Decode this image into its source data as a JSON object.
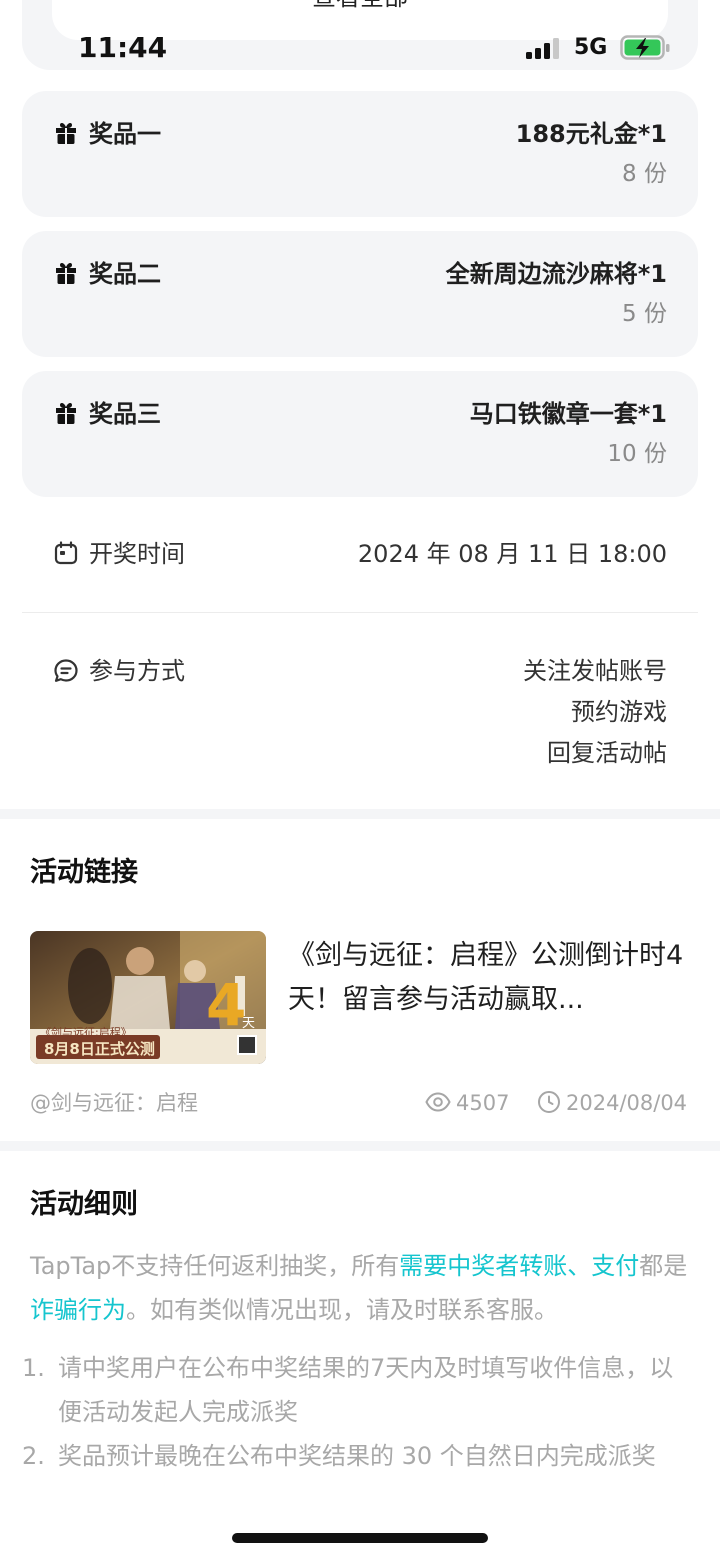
{
  "status_bar": {
    "time": "11:44",
    "network": "5G",
    "signal_bars": 3,
    "battery": "charging"
  },
  "top_card": {
    "view_all_label": "查看全部"
  },
  "prizes": [
    {
      "label": "奖品一",
      "name": "188元礼金*1",
      "count": "8 份"
    },
    {
      "label": "奖品二",
      "name": "全新周边流沙麻将*1",
      "count": "5 份"
    },
    {
      "label": "奖品三",
      "name": "马口铁徽章一套*1",
      "count": "10 份"
    }
  ],
  "draw_time": {
    "label": "开奖时间",
    "value": "2024 年 08 月 11 日 18:00"
  },
  "participation": {
    "label": "参与方式",
    "methods": [
      "关注发帖账号",
      "预约游戏",
      "回复活动帖"
    ]
  },
  "activity_link": {
    "section_title": "活动链接",
    "title": "《剑与远征：启程》公测倒计时4天！留言参与活动赢取...",
    "thumb_caption": "《剑与远征:启程》",
    "thumb_date_text": "8月8日正式公测",
    "thumb_big_number": "4",
    "thumb_day_char": "天",
    "author": "@剑与远征：启程",
    "views": "4507",
    "date": "2024/08/04"
  },
  "rules": {
    "section_title": "活动细则",
    "warning_parts": [
      {
        "text": "TapTap不支持任何返利抽奖，所有",
        "highlight": false
      },
      {
        "text": "需要中奖者转账、支付",
        "highlight": true
      },
      {
        "text": "都是",
        "highlight": false
      },
      {
        "text": "诈骗行为",
        "highlight": true
      },
      {
        "text": "。如有类似情况出现，请及时联系客服。",
        "highlight": false
      }
    ],
    "items": [
      {
        "num": "1.",
        "text": "请中奖用户在公布中奖结果的7天内及时填写收件信息，以便活动发起人完成派奖"
      },
      {
        "num": "2.",
        "text": "奖品预计最晚在公布中奖结果的 30 个自然日内完成派奖"
      }
    ]
  },
  "colors": {
    "accent": "#15c5ce",
    "card_bg": "#f4f5f7",
    "muted_text": "#a8a8a8"
  }
}
